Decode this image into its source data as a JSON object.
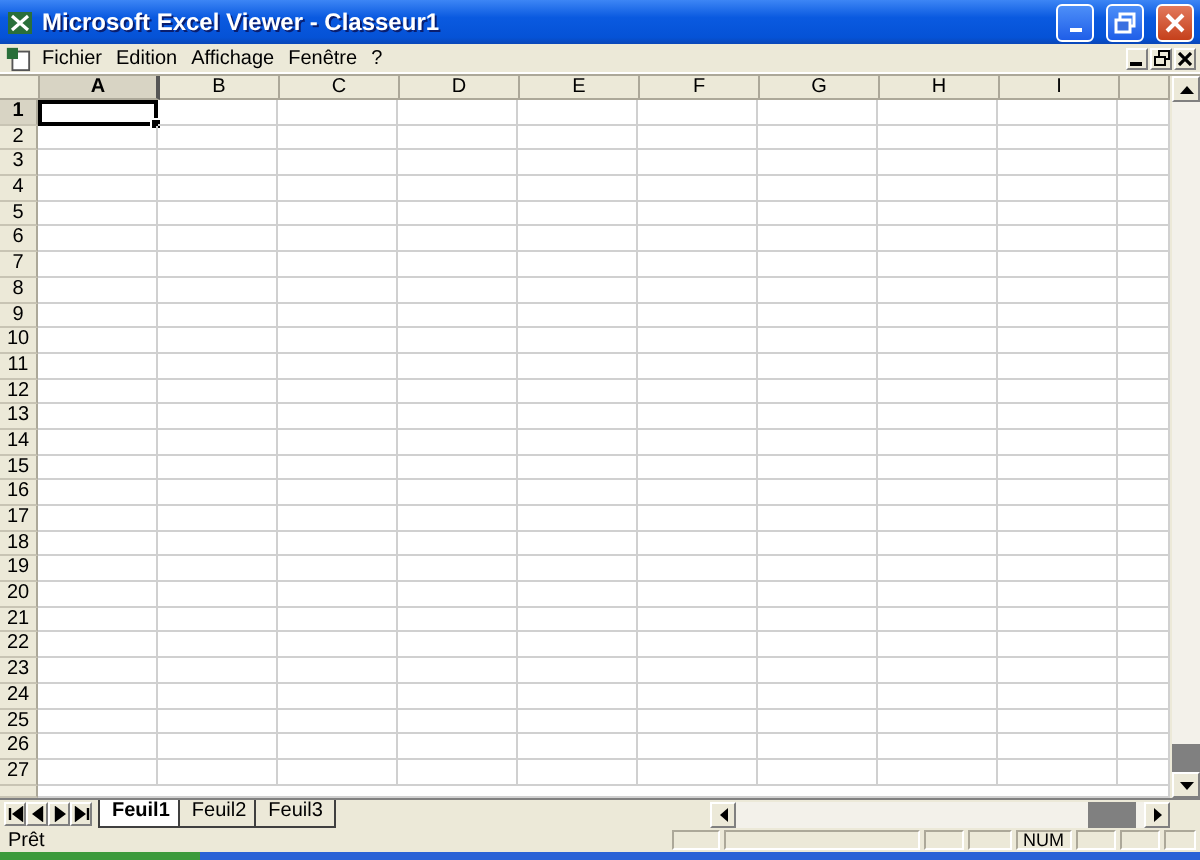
{
  "window": {
    "title": "Microsoft Excel Viewer - Classeur1"
  },
  "menu": [
    {
      "label": "Fichier"
    },
    {
      "label": "Edition"
    },
    {
      "label": "Affichage"
    },
    {
      "label": "Fenêtre"
    },
    {
      "label": "?"
    }
  ],
  "columns": [
    {
      "label": "A",
      "selected": true
    },
    {
      "label": "B",
      "selected": false
    },
    {
      "label": "C",
      "selected": false
    },
    {
      "label": "D",
      "selected": false
    },
    {
      "label": "E",
      "selected": false
    },
    {
      "label": "F",
      "selected": false
    },
    {
      "label": "G",
      "selected": false
    },
    {
      "label": "H",
      "selected": false
    },
    {
      "label": "I",
      "selected": false
    }
  ],
  "rows": [
    {
      "label": "1",
      "selected": true
    },
    {
      "label": "2",
      "selected": false
    },
    {
      "label": "3",
      "selected": false
    },
    {
      "label": "4",
      "selected": false
    },
    {
      "label": "5",
      "selected": false
    },
    {
      "label": "6",
      "selected": false
    },
    {
      "label": "7",
      "selected": false
    },
    {
      "label": "8",
      "selected": false
    },
    {
      "label": "9",
      "selected": false
    },
    {
      "label": "10",
      "selected": false
    },
    {
      "label": "11",
      "selected": false
    },
    {
      "label": "12",
      "selected": false
    },
    {
      "label": "13",
      "selected": false
    },
    {
      "label": "14",
      "selected": false
    },
    {
      "label": "15",
      "selected": false
    },
    {
      "label": "16",
      "selected": false
    },
    {
      "label": "17",
      "selected": false
    },
    {
      "label": "18",
      "selected": false
    },
    {
      "label": "19",
      "selected": false
    },
    {
      "label": "20",
      "selected": false
    },
    {
      "label": "21",
      "selected": false
    },
    {
      "label": "22",
      "selected": false
    },
    {
      "label": "23",
      "selected": false
    },
    {
      "label": "24",
      "selected": false
    },
    {
      "label": "25",
      "selected": false
    },
    {
      "label": "26",
      "selected": false
    },
    {
      "label": "27",
      "selected": false
    }
  ],
  "sheet_tabs": [
    {
      "label": "Feuil1",
      "selected": true
    },
    {
      "label": "Feuil2",
      "selected": false
    },
    {
      "label": "Feuil3",
      "selected": false
    }
  ],
  "status_bar": {
    "message": "Prêt",
    "indicators": [
      {
        "label": "NUM"
      }
    ]
  }
}
